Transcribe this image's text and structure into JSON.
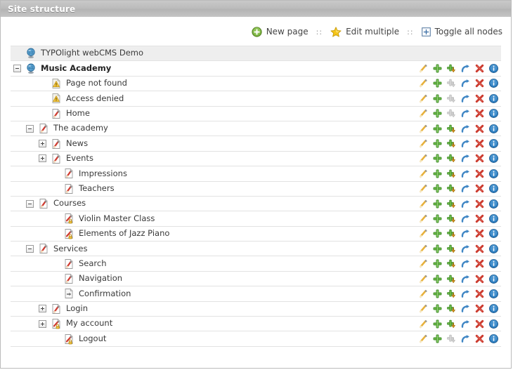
{
  "window": {
    "title": "Site structure"
  },
  "toolbar": {
    "items": [
      {
        "label": "New page",
        "icon": "plus-circle-green-icon"
      },
      {
        "label": "Edit multiple",
        "icon": "star-yellow-icon"
      },
      {
        "label": "Toggle all nodes",
        "icon": "expand-box-icon"
      }
    ],
    "separator": "::"
  },
  "colors": {
    "titlebar": "#bcbcbc",
    "row_border": "#e2e2e2",
    "shaded_row": "#eeeeee",
    "accent_green": "#6ab04c",
    "accent_red": "#cc3333",
    "accent_blue": "#3a7fc1",
    "accent_yellow": "#e8b13a"
  },
  "actions_labels": {
    "edit": "Edit page",
    "new": "New page",
    "paste": "Paste after",
    "move": "Move page",
    "delete": "Delete page",
    "info": "Page details"
  },
  "tree": {
    "rows": [
      {
        "label": "TYPOlight webCMS Demo",
        "indent": 0,
        "toggle": "none",
        "icon": "globe-icon",
        "shaded": true,
        "bold": false,
        "actions": false
      },
      {
        "label": "Music Academy",
        "indent": 0,
        "toggle": "minus",
        "icon": "globe-icon",
        "shaded": false,
        "bold": true,
        "actions": true,
        "paste_dim": false
      },
      {
        "label": "Page not found",
        "indent": 2,
        "toggle": "none",
        "icon": "warning-page-icon",
        "shaded": false,
        "bold": false,
        "actions": true,
        "paste_dim": true
      },
      {
        "label": "Access denied",
        "indent": 2,
        "toggle": "none",
        "icon": "warning-page-icon",
        "shaded": false,
        "bold": false,
        "actions": true,
        "paste_dim": true
      },
      {
        "label": "Home",
        "indent": 2,
        "toggle": "none",
        "icon": "page-icon",
        "shaded": false,
        "bold": false,
        "actions": true,
        "paste_dim": true
      },
      {
        "label": "The academy",
        "indent": 1,
        "toggle": "minus",
        "icon": "page-icon",
        "shaded": false,
        "bold": false,
        "actions": true,
        "paste_dim": false
      },
      {
        "label": "News",
        "indent": 2,
        "toggle": "plus",
        "icon": "page-icon",
        "shaded": false,
        "bold": false,
        "actions": true,
        "paste_dim": false
      },
      {
        "label": "Events",
        "indent": 2,
        "toggle": "plus",
        "icon": "page-icon",
        "shaded": false,
        "bold": false,
        "actions": true,
        "paste_dim": false
      },
      {
        "label": "Impressions",
        "indent": 3,
        "toggle": "none",
        "icon": "page-icon",
        "shaded": false,
        "bold": false,
        "actions": true,
        "paste_dim": false
      },
      {
        "label": "Teachers",
        "indent": 3,
        "toggle": "none",
        "icon": "page-icon",
        "shaded": false,
        "bold": false,
        "actions": true,
        "paste_dim": false
      },
      {
        "label": "Courses",
        "indent": 1,
        "toggle": "minus",
        "icon": "page-icon",
        "shaded": false,
        "bold": false,
        "actions": true,
        "paste_dim": false
      },
      {
        "label": "Violin Master Class",
        "indent": 3,
        "toggle": "none",
        "icon": "protected-page-icon",
        "shaded": false,
        "bold": false,
        "actions": true,
        "paste_dim": false
      },
      {
        "label": "Elements of Jazz Piano",
        "indent": 3,
        "toggle": "none",
        "icon": "protected-page-icon",
        "shaded": false,
        "bold": false,
        "actions": true,
        "paste_dim": false
      },
      {
        "label": "Services",
        "indent": 1,
        "toggle": "minus",
        "icon": "page-icon",
        "shaded": false,
        "bold": false,
        "actions": true,
        "paste_dim": false
      },
      {
        "label": "Search",
        "indent": 3,
        "toggle": "none",
        "icon": "page-icon",
        "shaded": false,
        "bold": false,
        "actions": true,
        "paste_dim": false
      },
      {
        "label": "Navigation",
        "indent": 3,
        "toggle": "none",
        "icon": "page-icon",
        "shaded": false,
        "bold": false,
        "actions": true,
        "paste_dim": false
      },
      {
        "label": "Confirmation",
        "indent": 3,
        "toggle": "none",
        "icon": "redirect-page-icon",
        "shaded": false,
        "bold": false,
        "actions": true,
        "paste_dim": false
      },
      {
        "label": "Login",
        "indent": 2,
        "toggle": "plus",
        "icon": "page-icon",
        "shaded": false,
        "bold": false,
        "actions": true,
        "paste_dim": false
      },
      {
        "label": "My account",
        "indent": 2,
        "toggle": "plus",
        "icon": "protected-page-icon",
        "shaded": false,
        "bold": false,
        "actions": true,
        "paste_dim": false
      },
      {
        "label": "Logout",
        "indent": 3,
        "toggle": "none",
        "icon": "protected-page-icon",
        "shaded": false,
        "bold": false,
        "actions": true,
        "paste_dim": true
      }
    ]
  }
}
